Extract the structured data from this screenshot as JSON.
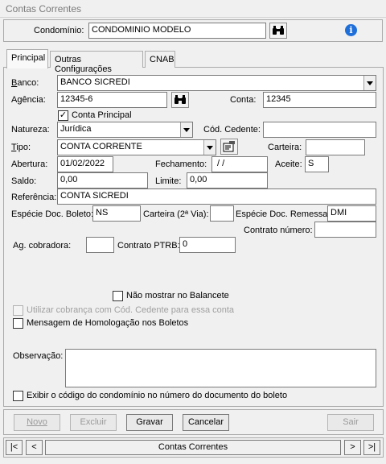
{
  "window": {
    "title": "Contas Correntes"
  },
  "header": {
    "condominio_label": "Condomínio:",
    "condominio_value": "CONDOMINIO MODELO"
  },
  "tabs": [
    {
      "label": "Principal",
      "active": true
    },
    {
      "label": "Outras Configurações",
      "active": false
    },
    {
      "label": "CNAB",
      "active": false
    }
  ],
  "form": {
    "banco_label": "Banco:",
    "banco_value": "BANCO SICREDI",
    "agencia_label": "Agência:",
    "agencia_value": "12345-6",
    "conta_label": "Conta:",
    "conta_value": "12345",
    "conta_principal_label": "Conta Principal",
    "conta_principal_checked": true,
    "natureza_label": "Natureza:",
    "natureza_value": "Jurídica",
    "cod_cedente_label": "Cód. Cedente:",
    "cod_cedente_value": "",
    "tipo_label": "Tipo:",
    "tipo_value": "CONTA CORRENTE",
    "carteira_label": "Carteira:",
    "carteira_value": "",
    "abertura_label": "Abertura:",
    "abertura_value": "01/02/2022",
    "fechamento_label": "Fechamento:",
    "fechamento_value": " / /",
    "aceite_label": "Aceite:",
    "aceite_value": "S",
    "saldo_label": "Saldo:",
    "saldo_value": "0,00",
    "limite_label": "Limite:",
    "limite_value": "0,00",
    "referencia_label": "Referência:",
    "referencia_value": "CONTA SICREDI",
    "especie_boleto_label": "Espécie Doc. Boleto:",
    "especie_boleto_value": "NS",
    "carteira2_label": "Carteira (2ª Via):",
    "carteira2_value": "",
    "especie_remessa_label": "Espécie Doc. Remessa:",
    "especie_remessa_value": "DMI",
    "contrato_numero_label": "Contrato número:",
    "contrato_numero_value": "",
    "ag_cobradora_label": "Ag. cobradora:",
    "ag_cobradora_value": "",
    "contrato_ptrb_label": "Contrato PTRB:",
    "contrato_ptrb_value": "0",
    "nao_mostrar_label": "Não mostrar no Balancete",
    "utilizar_cobranca_label": "Utilizar cobrança com Cód. Cedente para essa conta",
    "mensagem_homologacao_label": "Mensagem de Homologação nos Boletos",
    "observacao_label": "Observação:",
    "observacao_value": "",
    "exibir_codigo_label": "Exibir o código do condomínio no número do documento do boleto"
  },
  "buttons": {
    "novo": "Novo",
    "excluir": "Excluir",
    "gravar": "Gravar",
    "cancelar": "Cancelar",
    "sair": "Sair"
  },
  "nav": {
    "first": "|<",
    "prev": "<",
    "title": "Contas Correntes",
    "next": ">",
    "last": ">|"
  },
  "icons": {
    "search": "binoculars-icon",
    "info": "info-icon",
    "tipo_button": "form-edit-icon"
  }
}
